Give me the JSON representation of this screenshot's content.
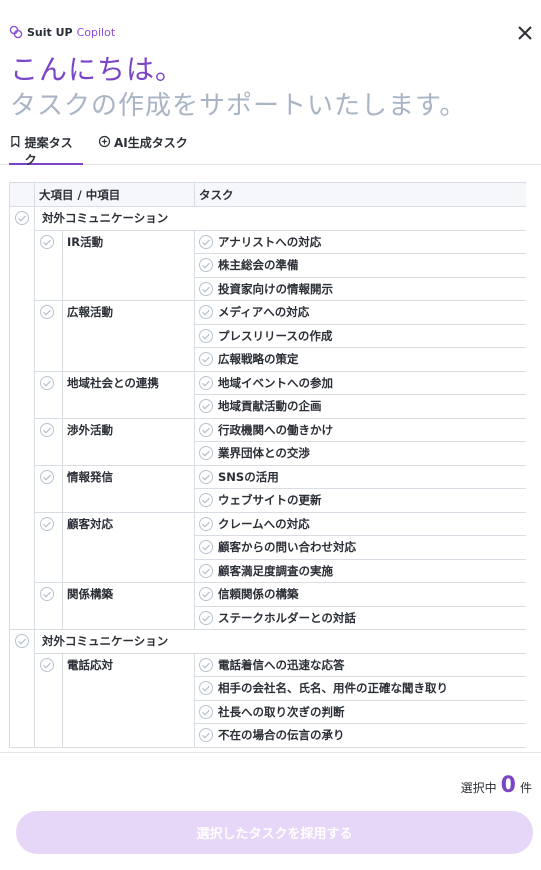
{
  "brand": {
    "name": "Suit UP",
    "sub": "Copilot",
    "color": "#8b4fd6"
  },
  "greeting": {
    "line1": "こんにちは。",
    "line2": "タスクの作成をサポートいたします。"
  },
  "tabs": [
    {
      "label": "提案タスク",
      "icon": "bookmark-icon",
      "active": true
    },
    {
      "label": "AI生成タスク",
      "icon": "ai-sparkle-icon",
      "active": false
    }
  ],
  "table": {
    "headers": [
      "大項目 / 中項目",
      "タスク"
    ],
    "categories": [
      {
        "label": "対外コミュニケーション",
        "groups": [
          {
            "label": "IR活動",
            "tasks": [
              "アナリストへの対応",
              "株主総会の準備",
              "投資家向けの情報開示"
            ]
          },
          {
            "label": "広報活動",
            "tasks": [
              "メディアへの対応",
              "プレスリリースの作成",
              "広報戦略の策定"
            ]
          },
          {
            "label": "地域社会との連携",
            "tasks": [
              "地域イベントへの参加",
              "地域貢献活動の企画"
            ]
          },
          {
            "label": "渉外活動",
            "tasks": [
              "行政機関への働きかけ",
              "業界団体との交渉"
            ]
          },
          {
            "label": "情報発信",
            "tasks": [
              "SNSの活用",
              "ウェブサイトの更新"
            ]
          },
          {
            "label": "顧客対応",
            "tasks": [
              "クレームへの対応",
              "顧客からの問い合わせ対応",
              "顧客満足度調査の実施"
            ]
          },
          {
            "label": "関係構築",
            "tasks": [
              "信頼関係の構築",
              "ステークホルダーとの対話"
            ]
          }
        ]
      },
      {
        "label": "対外コミュニケーション",
        "groups": [
          {
            "label": "電話応対",
            "tasks": [
              "電話着信への迅速な応答",
              "相手の会社名、氏名、用件の正確な聞き取り",
              "社長への取り次ぎの判断",
              "不在の場合の伝言の承り"
            ]
          }
        ]
      }
    ]
  },
  "footer": {
    "count_prefix": "選択中",
    "count": "0",
    "count_suffix": "件",
    "adopt_label": "選択したタスクを採用する"
  },
  "colors": {
    "accent": "#7b45c8",
    "muted_heading": "#a9b4c4",
    "button_disabled": "#e6d6f8"
  }
}
